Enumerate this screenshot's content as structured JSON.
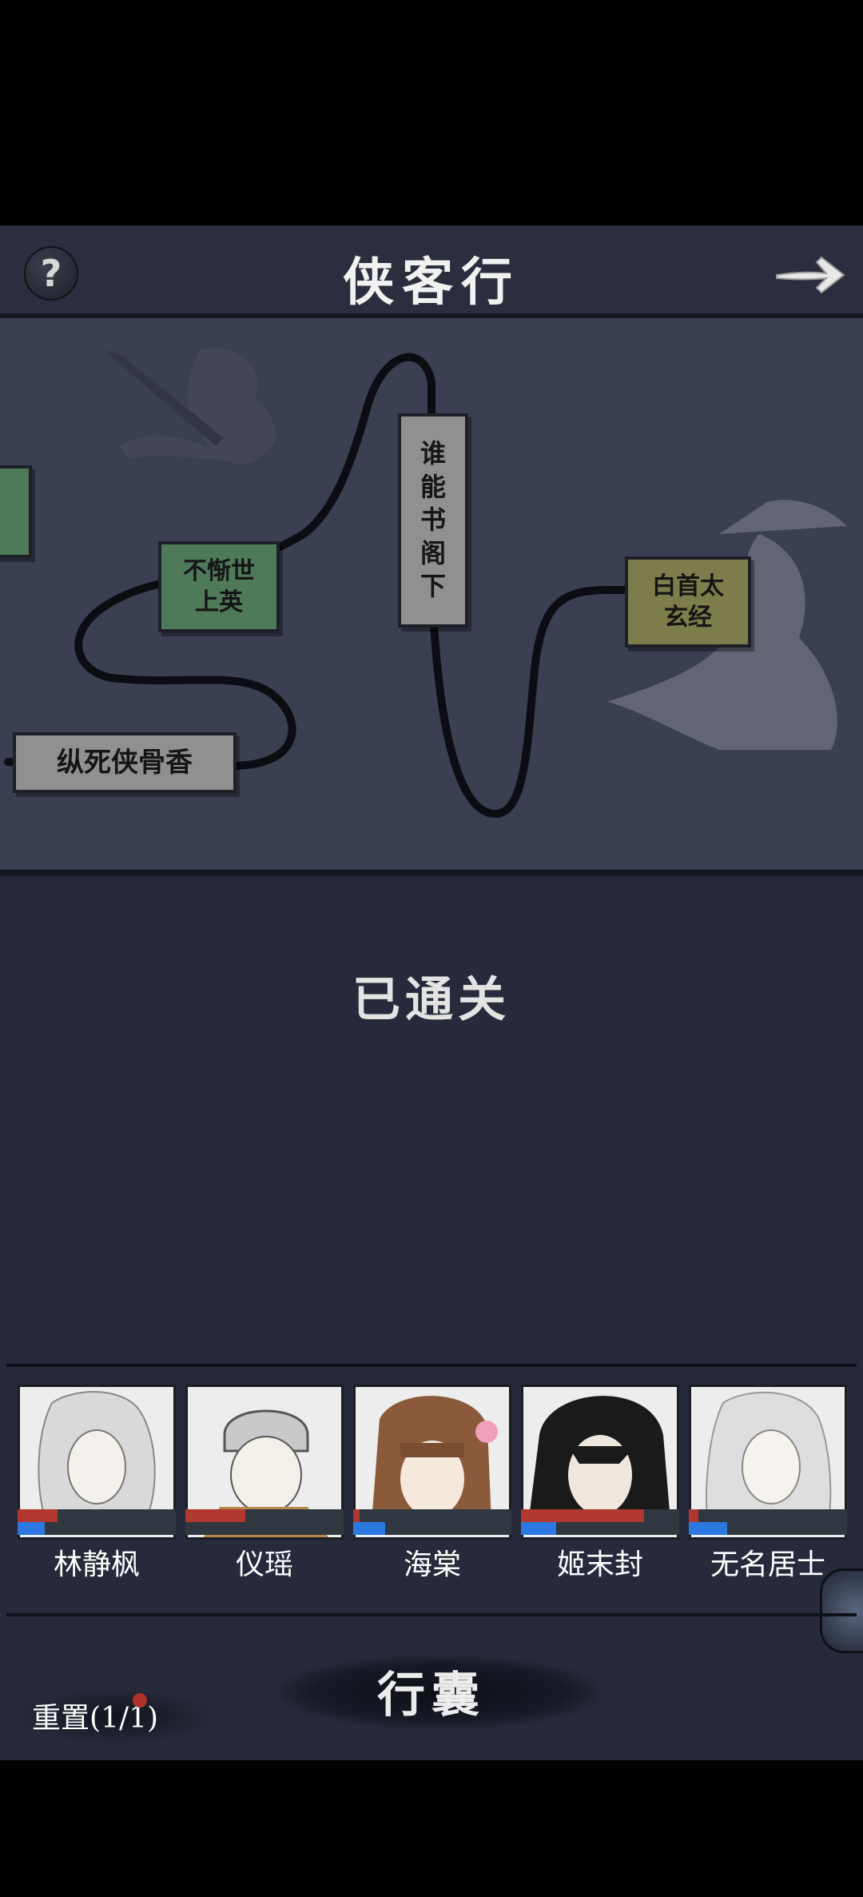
{
  "header": {
    "help_icon": "?",
    "title": "侠客行",
    "next_icon": "arrow-right-icon"
  },
  "map": {
    "nodes": [
      {
        "label": "",
        "color": "#4f7a5a"
      },
      {
        "label": "不惭世上英",
        "color": "#4f7a5a"
      },
      {
        "label": "谁能书阁下",
        "color": "#909090"
      },
      {
        "label": "白首太玄经",
        "color": "#7d7d4c"
      },
      {
        "label": "纵死侠骨香",
        "color": "#909090"
      }
    ]
  },
  "status": {
    "cleared": "已通关"
  },
  "party": [
    {
      "name": "林静枫",
      "hp": 0.25,
      "mp": 0.17
    },
    {
      "name": "仪瑶",
      "hp": 0.38,
      "mp": 0.0
    },
    {
      "name": "海棠",
      "hp": 0.04,
      "mp": 0.2
    },
    {
      "name": "姬末封",
      "hp": 0.78,
      "mp": 0.22
    },
    {
      "name": "无名居士",
      "hp": 0.06,
      "mp": 0.24
    }
  ],
  "bottom": {
    "bag_label": "行囊",
    "reset_label": "重置(1/1)"
  },
  "colors": {
    "background": "#262a3a",
    "map": "#3b3f52",
    "hp": "#b0382e",
    "mp": "#2b78e0"
  }
}
